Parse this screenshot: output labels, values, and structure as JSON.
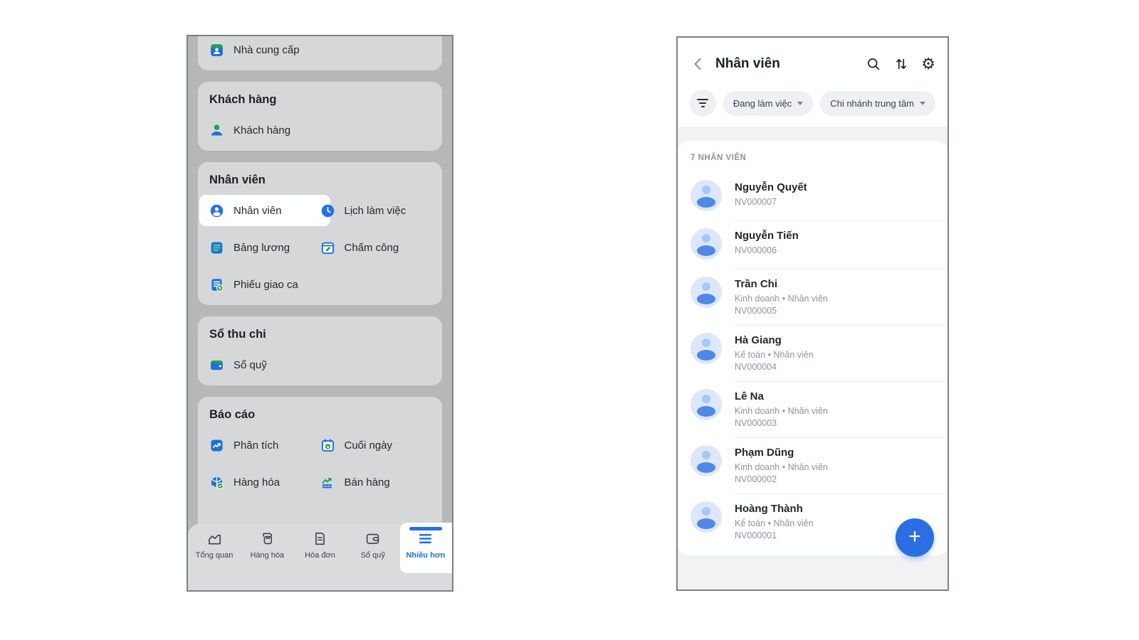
{
  "colors": {
    "accent_blue": "#2270e8",
    "icon_green": "#1fa346",
    "fab_blue": "#2b6de3",
    "dim_background": "#b5b7b9",
    "dim_card": "#d5d7d9",
    "spotlight_white": "#ffffff"
  },
  "left_screen": {
    "partial_item": {
      "label": "Nhà cung cấp",
      "icon": "supplier-icon"
    },
    "sections": [
      {
        "title": "Khách hàng",
        "items": [
          {
            "label": "Khách hàng",
            "icon": "customer-icon"
          }
        ]
      },
      {
        "title": "Nhân viên",
        "items": [
          {
            "label": "Nhân viên",
            "icon": "employee-icon",
            "highlighted": true
          },
          {
            "label": "Lịch làm việc",
            "icon": "work-schedule-icon"
          },
          {
            "label": "Bảng lương",
            "icon": "payroll-icon"
          },
          {
            "label": "Chấm công",
            "icon": "timekeeping-icon"
          },
          {
            "label": "Phiếu giao ca",
            "icon": "shift-handover-icon"
          }
        ]
      },
      {
        "title": "Sổ thu chi",
        "items": [
          {
            "label": "Sổ quỹ",
            "icon": "cash-book-icon"
          }
        ]
      },
      {
        "title": "Báo cáo",
        "items": [
          {
            "label": "Phân tích",
            "icon": "analytics-icon"
          },
          {
            "label": "Cuối ngày",
            "icon": "end-of-day-icon"
          },
          {
            "label": "Hàng hóa",
            "icon": "goods-report-icon"
          },
          {
            "label": "Bán hàng",
            "icon": "sales-report-icon"
          }
        ]
      }
    ],
    "bottom_nav": [
      {
        "label": "Tổng quan",
        "icon": "overview-icon",
        "active": false
      },
      {
        "label": "Hàng hóa",
        "icon": "products-icon",
        "active": false
      },
      {
        "label": "Hóa đơn",
        "icon": "invoice-icon",
        "active": false
      },
      {
        "label": "Sổ quỹ",
        "icon": "wallet-icon",
        "active": false
      },
      {
        "label": "Nhiều hơn",
        "icon": "more-menu-icon",
        "active": true
      }
    ]
  },
  "right_screen": {
    "header": {
      "title": "Nhân viên",
      "icons": [
        "back-icon",
        "search-icon",
        "sort-icon",
        "settings-gear-icon"
      ]
    },
    "filters": {
      "filter_icon": "filter-lines-icon",
      "chips": [
        {
          "label": "Đang làm việc"
        },
        {
          "label": "Chi nhánh trung tâm"
        }
      ]
    },
    "list": {
      "count_label": "7 NHÂN VIÊN",
      "employees": [
        {
          "name": "Nguyễn Quyết",
          "role": "",
          "id": "NV000007"
        },
        {
          "name": "Nguyễn Tiến",
          "role": "",
          "id": "NV000006"
        },
        {
          "name": "Trần Chi",
          "role": "Kinh doanh • Nhân viên",
          "id": "NV000005"
        },
        {
          "name": "Hà Giang",
          "role": "Kế toán • Nhân viên",
          "id": "NV000004"
        },
        {
          "name": "Lê Na",
          "role": "Kinh doanh • Nhân viên",
          "id": "NV000003"
        },
        {
          "name": "Phạm Dũng",
          "role": "Kinh doanh • Nhân viên",
          "id": "NV000002"
        },
        {
          "name": "Hoàng Thành",
          "role": "Kế toán • Nhân viên",
          "id": "NV000001"
        }
      ]
    },
    "fab_label": "+"
  }
}
